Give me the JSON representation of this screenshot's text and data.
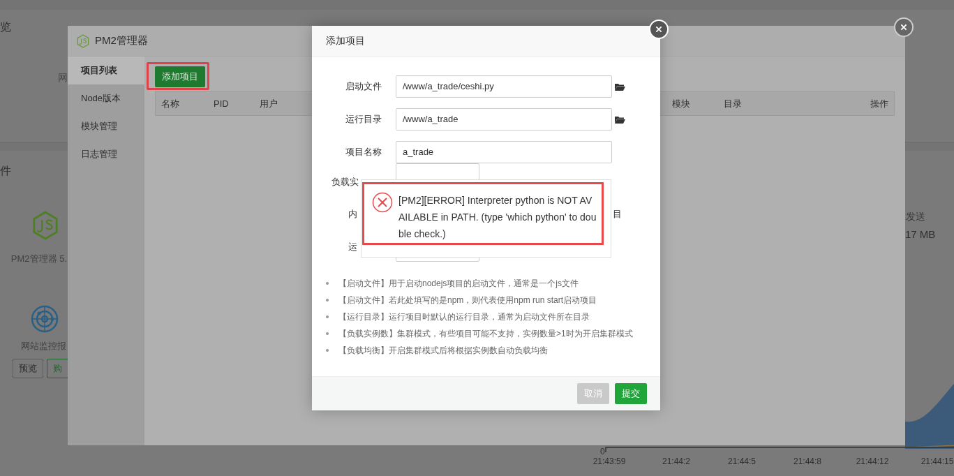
{
  "background": {
    "overview_title": "览",
    "network_label": "网",
    "software_title": "件",
    "pm2_card": {
      "name": "PM2管理器 5."
    },
    "monitor_card": {
      "name": "网站监控报",
      "buttons": [
        {
          "label": "预览",
          "kind": "plain"
        },
        {
          "label": "购",
          "kind": "buy"
        }
      ]
    },
    "traffic": {
      "label": "发送",
      "value": "17 MB"
    },
    "chart": {
      "y_label": "0",
      "x_labels": [
        "21:43:59",
        "21:44:2",
        "21:44:5",
        "21:44:8",
        "21:44:12",
        "21:44:15"
      ]
    }
  },
  "pm2_window": {
    "title": "PM2管理器",
    "nav": [
      {
        "label": "项目列表",
        "selected": true
      },
      {
        "label": "Node版本",
        "selected": false
      },
      {
        "label": "模块管理",
        "selected": false
      },
      {
        "label": "日志管理",
        "selected": false
      }
    ],
    "add_button": "添加项目",
    "table": {
      "columns_left": [
        "名称",
        "PID",
        "用户"
      ],
      "columns_right": [
        "模块",
        "目录"
      ],
      "action_column": "操作"
    }
  },
  "modal": {
    "title": "添加项目",
    "fields": [
      {
        "label": "启动文件",
        "value": "/www/a_trade/ceshi.py",
        "kind": "path"
      },
      {
        "label": "运行目录",
        "value": "/www/a_trade",
        "kind": "path"
      },
      {
        "label": "项目名称",
        "value": "a_trade",
        "kind": "text"
      }
    ],
    "covered_labels": [
      "负载实",
      "内",
      "运"
    ],
    "covered_right_label": "目",
    "error": "[PM2][ERROR] Interpreter python is NOT AVAILABLE in PATH. (type 'which python' to double check.)",
    "hints": [
      "【启动文件】用于启动nodejs项目的启动文件，通常是一个js文件",
      "【启动文件】若此处填写的是npm，则代表使用npm run start启动项目",
      "【运行目录】运行项目时默认的运行目录，通常为启动文件所在目录",
      "【负载实例数】集群模式，有些项目可能不支持，实例数量>1时为开启集群模式",
      "【负载均衡】开启集群模式后将根据实例数自动负载均衡"
    ],
    "buttons": [
      {
        "label": "取消",
        "kind": "cancel"
      },
      {
        "label": "提交",
        "kind": "submit"
      }
    ]
  }
}
